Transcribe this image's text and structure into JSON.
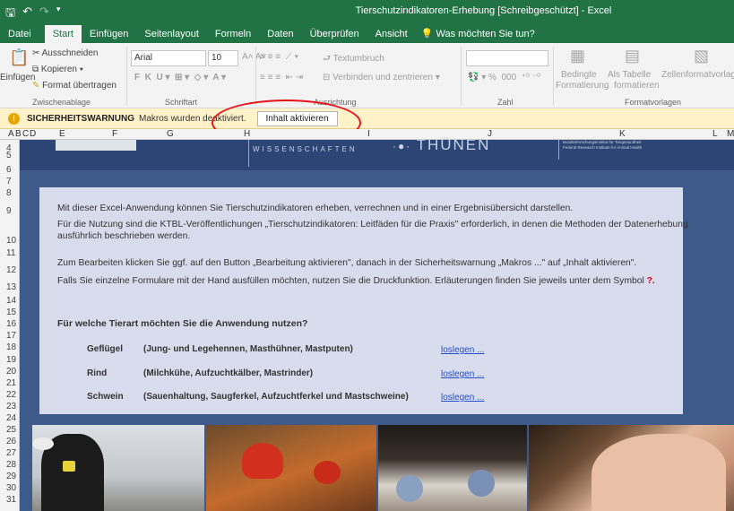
{
  "window": {
    "title": "Tierschutzindikatoren-Erhebung  [Schreibgeschützt]  -  Excel"
  },
  "tabs": [
    "Datei",
    "Start",
    "Einfügen",
    "Seitenlayout",
    "Formeln",
    "Daten",
    "Überprüfen",
    "Ansicht"
  ],
  "active_tab": "Start",
  "tell_me": "Was möchten Sie tun?",
  "ribbon": {
    "paste": "Einfügen",
    "cut": "Ausschneiden",
    "copy": "Kopieren",
    "format_painter": "Format übertragen",
    "group_clipboard": "Zwischenablage",
    "font_name": "Arial",
    "font_size": "10",
    "group_font": "Schriftart",
    "wrap_text": "Textumbruch",
    "merge_center": "Verbinden und zentrieren",
    "group_alignment": "Ausrichtung",
    "group_number": "Zahl",
    "cond_format_1": "Bedingte",
    "cond_format_2": "Formatierung",
    "as_table_1": "Als Tabelle",
    "as_table_2": "formatieren",
    "cell_styles": "Zellenformatvorlagen",
    "group_styles": "Formatvorlagen"
  },
  "security": {
    "title": "SICHERHEITSWARNUNG",
    "message": "Makros wurden deaktiviert.",
    "button": "Inhalt aktivieren"
  },
  "columns": [
    "A",
    "B",
    "C",
    "D",
    "E",
    "F",
    "G",
    "H",
    "I",
    "J",
    "K",
    "L",
    "M"
  ],
  "rows": [
    "4",
    "5",
    "6",
    "7",
    "8",
    "9",
    "10",
    "11",
    "12",
    "13",
    "14",
    "15",
    "16",
    "17",
    "18",
    "19",
    "20",
    "21",
    "22",
    "23",
    "24",
    "25",
    "26",
    "27",
    "28",
    "29",
    "30",
    "31"
  ],
  "banner": {
    "wissenschaften": "WISSENSCHAFTEN",
    "thuenen": "THÜNEN",
    "fli_1": "Bundesforschungsinstitut für Tiergesundheit",
    "fli_2": "Federal Research Institute for Animal Health"
  },
  "content": {
    "line1": "Mit dieser Excel-Anwendung können Sie Tierschutzindikatoren erheben, verrechnen und in einer Ergebnisübersicht darstellen.",
    "line2a": "Für die Nutzung sind die KTBL-Veröffentlichungen „Tierschutzindikatoren: Leitfäden für die Praxis\" erforderlich, in denen die Methoden der Datenerhebung",
    "line2b": "ausführlich beschrieben werden.",
    "line3": "Zum Bearbeiten klicken Sie ggf. auf den Button „Bearbeitung aktivieren\", danach in der Sicherheitswarnung „Makros ...\" auf „Inhalt aktivieren\".",
    "line4": "Falls Sie einzelne Formulare mit der Hand ausfüllen möchten, nutzen Sie die Druckfunktion. Erläuterungen finden Sie jeweils unter dem Symbol",
    "line4_symbol": "?.",
    "question": "Für welche Tierart möchten Sie die Anwendung nutzen?"
  },
  "animals": [
    {
      "name": "Geflügel",
      "desc": "(Jung- und Legehennen, Masthühner, Mastputen)",
      "link": "loslegen ..."
    },
    {
      "name": "Rind",
      "desc": "(Milchkühe, Aufzuchtkälber, Mastrinder)",
      "link": "loslegen ..."
    },
    {
      "name": "Schwein",
      "desc": "(Sauenhaltung, Saugferkel, Aufzuchtferkel und Mastschweine)",
      "link": "loslegen ..."
    }
  ]
}
